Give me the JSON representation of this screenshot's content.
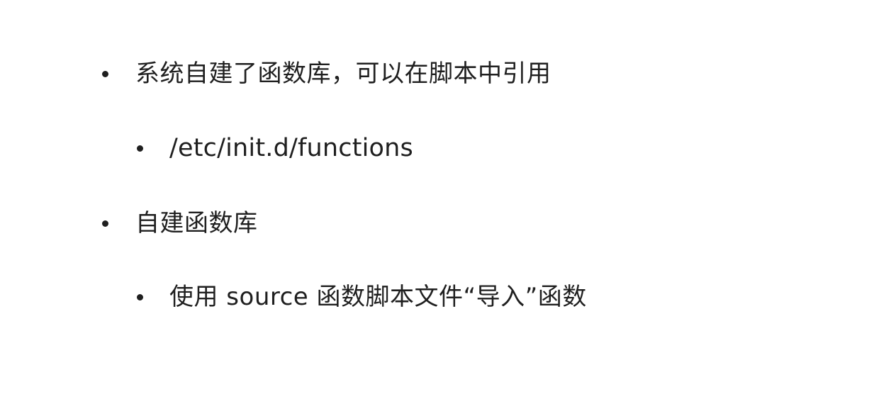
{
  "slide": {
    "bullets": [
      {
        "level": 1,
        "text": "系统自建了函数库，可以在脚本中引用"
      },
      {
        "level": 2,
        "text": "/etc/init.d/functions"
      },
      {
        "level": 1,
        "text": "自建函数库"
      },
      {
        "level": 2,
        "text": "使用 source  函数脚本文件“导入”函数"
      }
    ]
  }
}
